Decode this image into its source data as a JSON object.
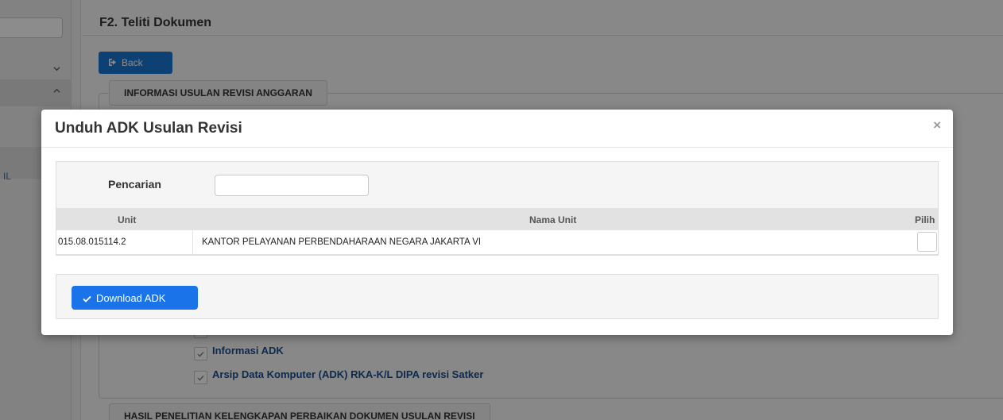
{
  "sidebar": {
    "partial_item_label": "IL"
  },
  "page": {
    "title": "F2. Teliti Dokumen",
    "back_label": "Back",
    "section_1_legend": "INFORMASI USULAN REVISI ANGGARAN",
    "section_2_legend": "HASIL PENELITIAN KELENGKAPAN PERBAIKAN DOKUMEN USULAN REVISI",
    "checklist": [
      {
        "label": "Informasi ADK"
      },
      {
        "label": "Arsip Data Komputer (ADK) RKA-K/L DIPA revisi Satker"
      }
    ]
  },
  "modal": {
    "title": "Unduh ADK Usulan Revisi",
    "close_glyph": "×",
    "search": {
      "label": "Pencarian",
      "value": "",
      "placeholder": ""
    },
    "table": {
      "columns": [
        "Unit",
        "Nama Unit",
        "Pilih"
      ],
      "rows": [
        {
          "unit": "015.08.015114.2",
          "nama_unit": "KANTOR PELAYANAN PERBENDAHARAAN NEGARA JAKARTA VI",
          "pilih": false
        }
      ]
    },
    "download_label": "Download ADK"
  },
  "icons": {
    "back": "sign-out-icon",
    "download": "check-icon",
    "chevron": "chevron-icon",
    "close": "close-icon"
  },
  "colors": {
    "primary_button": "#1a73e8",
    "link_text": "#1a4d8f"
  }
}
